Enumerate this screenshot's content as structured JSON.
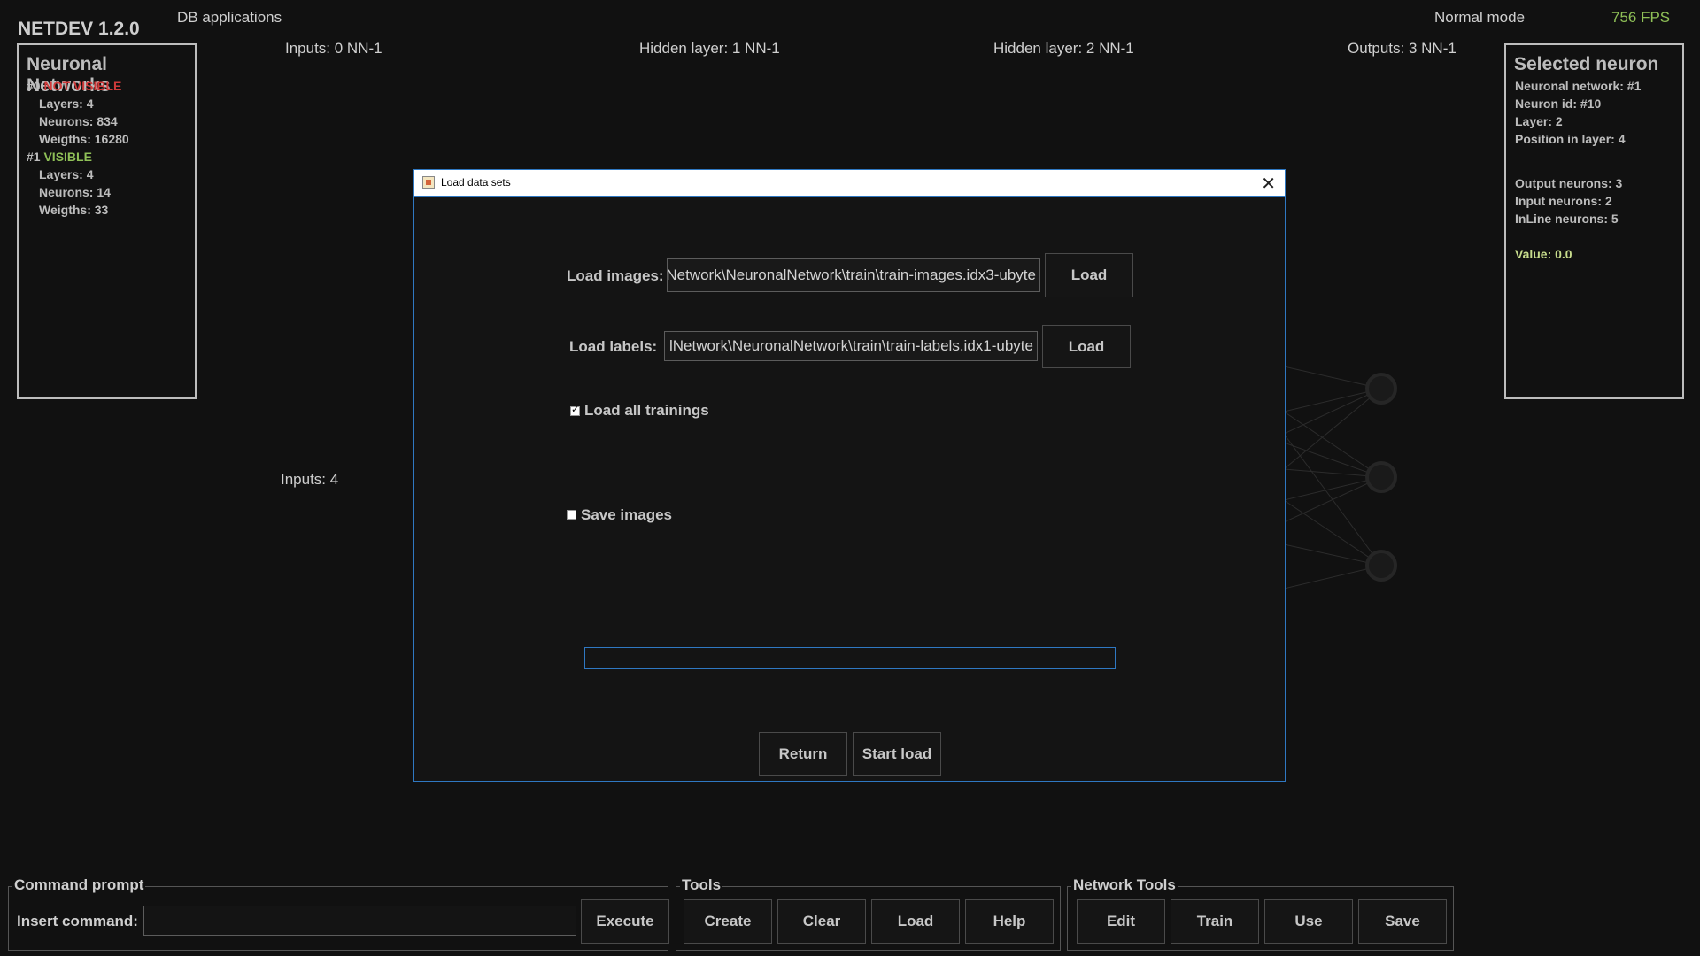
{
  "app": {
    "title": "NETDEV 1.2.0",
    "menu_item": "DB applications",
    "mode": "Normal mode",
    "fps": "756 FPS"
  },
  "layer_headers": [
    {
      "label": "Inputs: 0  NN-1"
    },
    {
      "label": "Hidden layer: 1  NN-1"
    },
    {
      "label": "Hidden layer: 2  NN-1"
    },
    {
      "label": "Outputs: 3  NN-1"
    }
  ],
  "side_label": "Inputs: 4",
  "left_panel": {
    "title": "Neuronal Networks",
    "networks": [
      {
        "id": "#0",
        "status": "NOT VISIBLE",
        "layers": "Layers: 4",
        "neurons": "Neurons: 834",
        "weights": "Weigths: 16280"
      },
      {
        "id": "#1",
        "status": "VISIBLE",
        "layers": "Layers: 4",
        "neurons": "Neurons: 14",
        "weights": "Weigths: 33"
      }
    ]
  },
  "right_panel": {
    "title": "Selected neuron",
    "network": "Neuronal network: #1",
    "neuron_id": "Neuron id: #10",
    "layer": "Layer: 2",
    "position": "Position in layer: 4",
    "output_neurons": "Output neurons: 3",
    "input_neurons": "Input neurons: 2",
    "inline_neurons": "InLine neurons: 5",
    "value": "Value: 0.0"
  },
  "dialog": {
    "title": "Load data sets",
    "images_label": "Load images:",
    "images_path": "Network\\NeuronalNetwork\\train\\train-images.idx3-ubyte",
    "images_button": "Load",
    "labels_label": "Load labels:",
    "labels_path": "lNetwork\\NeuronalNetwork\\train\\train-labels.idx1-ubyte",
    "labels_button": "Load",
    "load_all_label": "Load all trainings",
    "load_all_checked": true,
    "save_images_label": "Save images",
    "save_images_checked": false,
    "progress": 0,
    "return_button": "Return",
    "start_button": "Start load"
  },
  "command": {
    "group_title": "Command prompt",
    "label": "Insert command:",
    "value": "",
    "execute": "Execute"
  },
  "tools": {
    "group_title": "Tools",
    "buttons": [
      "Create",
      "Clear",
      "Load",
      "Help"
    ]
  },
  "network_tools": {
    "group_title": "Network Tools",
    "buttons": [
      "Edit",
      "Train",
      "Use",
      "Save"
    ]
  },
  "colors": {
    "accent": "#2f78c2",
    "not_visible": "#d03a3a",
    "visible": "#8fc057",
    "value": "#c7dc8c",
    "fps": "#8fc057"
  }
}
